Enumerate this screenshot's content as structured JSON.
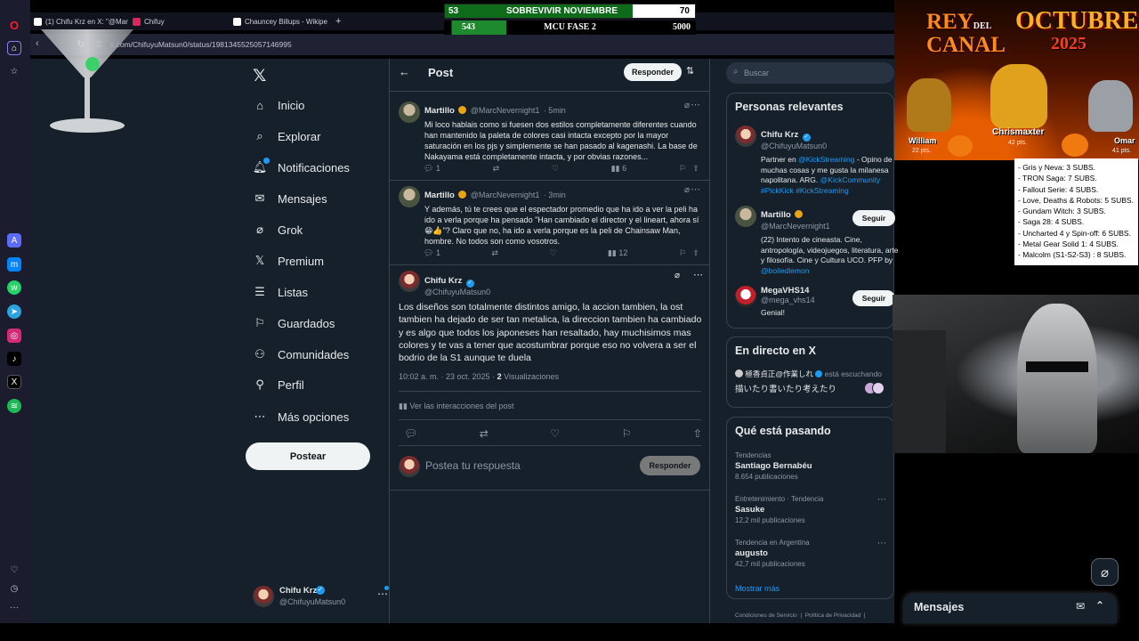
{
  "browser": {
    "tabs": [
      {
        "label": "(1) Chifu Krz en X: \"@Mar",
        "color": "#ffffff"
      },
      {
        "label": "Chifuy",
        "color": "#e0245e"
      },
      {
        "label": "Chauncey Billups - Wikipe",
        "color": "#ffffff"
      }
    ],
    "new_tab": "+",
    "url": "x.com/ChifuyuMatsun0/status/1981345525057146995"
  },
  "overlay": {
    "score1": {
      "left": "53",
      "title": "SOBREVIVIR NOVIEMBRE",
      "right": "70"
    },
    "score2": {
      "left": "543",
      "title": "MCU FASE 2",
      "right": "5000"
    },
    "banner": {
      "title1": "REY",
      "title_small": "DEL",
      "title2": "CANAL",
      "month": "OCTUBRE",
      "year": "2025",
      "players": [
        {
          "name": "William",
          "pts": "22 pts."
        },
        {
          "name": "Chrismaxter",
          "pts": "42 pts."
        },
        {
          "name": "Omar",
          "pts": "41 pts."
        }
      ]
    },
    "subs": [
      "- Gris y Neva: 3 SUBS.",
      "- TRON Saga: 7 SUBS.",
      "- Fallout Serie: 4 SUBS.",
      "- Love, Deaths & Robots: 5 SUBS.",
      "- Gundam Witch: 3 SUBS.",
      "- Saga 28: 4 SUBS.",
      "- Uncharted 4 y Spin-off: 6 SUBS.",
      "- Metal Gear Solid 1: 4 SUBS.",
      "- Malcolm (S1-S2-S3) : 8 SUBS."
    ]
  },
  "nav": {
    "items": [
      "Inicio",
      "Explorar",
      "Notificaciones",
      "Mensajes",
      "Grok",
      "Premium",
      "Listas",
      "Guardados",
      "Comunidades",
      "Perfil",
      "Más opciones"
    ],
    "postear": "Postear",
    "me_name": "Chifu Krz",
    "me_handle": "@ChifuyuMatsun0"
  },
  "post": {
    "header": "Post",
    "reply_btn": "Responder",
    "replies": [
      {
        "name": "Martillo",
        "handle": "@MarcNevernight1",
        "time": "· 5min",
        "text": "Mi loco hablais como si fuesen dos estilos completamente diferentes cuando han mantenido la paleta de colores casi intacta excepto por la mayor saturación en los pjs y simplemente se han pasado al kagenashi. La base de Nakayama está completamente intacta, y por obvias razones...",
        "comments": "1",
        "views": "6"
      },
      {
        "name": "Martillo",
        "handle": "@MarcNevernight1",
        "time": "· 3min",
        "text": "Y además, tú te crees que el espectador promedio que ha ido a ver la peli ha ido a verla porque ha pensado \"Han cambiado el director y el lineart, ahora sí 😁👍\"? Claro que no, ha ido a verla porque es la peli de Chainsaw Man, hombre. No todos son como vosotros.",
        "comments": "1",
        "views": "12"
      }
    ],
    "main": {
      "name": "Chifu Krz",
      "handle": "@ChifuyuMatsun0",
      "text": "Los diseños son totalmente distintos amigo, la accion tambien, la ost tambien ha dejado de ser tan metalica, la direccion tambien ha cambiado y es algo que todos los japoneses han resaltado, hay muchisimos mas colores y te vas a tener que acostumbrar porque eso no volvera a ser el bodrio de la S1 aunque te duela",
      "time": "10:02 a. m. · 23 oct. 2025 ·",
      "views_count": "2",
      "views_label": "Visualizaciones",
      "interactions": "Ver las interacciones del post"
    },
    "compose_placeholder": "Postea tu respuesta",
    "compose_btn": "Responder"
  },
  "sidebar": {
    "search_placeholder": "Buscar",
    "relevant_title": "Personas relevantes",
    "people": [
      {
        "name": "Chifu Krz",
        "handle": "@ChifuyuMatsun0",
        "bio_parts": [
          "Partner en ",
          "@KickStreaming",
          " - Opino de muchas cosas y me gusta la milanesa napolitana. ARG. ",
          "@KickCommunity",
          " ",
          "#PickKick #KickStreaming"
        ],
        "follow": ""
      },
      {
        "name": "Martillo",
        "handle": "@MarcNevernight1",
        "bio_parts": [
          "(22) Intento de cineasta. Cine, antropología, videojuegos, literatura, arte y filosofía. Cine y Cultura UCO. PFP by ",
          "@boiledlemon"
        ],
        "follow": "Seguir"
      },
      {
        "name": "MegaVHS14",
        "handle": "@mega_vhs14",
        "bio_parts": [
          "Genial!"
        ],
        "follow": "Seguir"
      }
    ],
    "live_title": "En directo en X",
    "live_user": "極香貞正@作業しれ",
    "live_status": "está escuchando",
    "live_text": "描いたり書いたり考えたり",
    "trends_title": "Qué está pasando",
    "trends": [
      {
        "context": "Tendencias",
        "name": "Santiago Bernabéu",
        "count": "8.654 publicaciones"
      },
      {
        "context": "Entretenimiento · Tendencia",
        "name": "Sasuke",
        "count": "12,2 mil publicaciones"
      },
      {
        "context": "Tendencia en Argentina",
        "name": "augusto",
        "count": "42,7 mil publicaciones"
      }
    ],
    "show_more": "Mostrar más",
    "footer": [
      "Condiciones de Servicio",
      "|",
      "Política de Privacidad",
      "|"
    ]
  },
  "messages_bar": "Mensajes",
  "colors": {
    "bg": "#15202b",
    "accent": "#1d9bf0",
    "border": "#38444d",
    "gold": "#e8a317"
  }
}
